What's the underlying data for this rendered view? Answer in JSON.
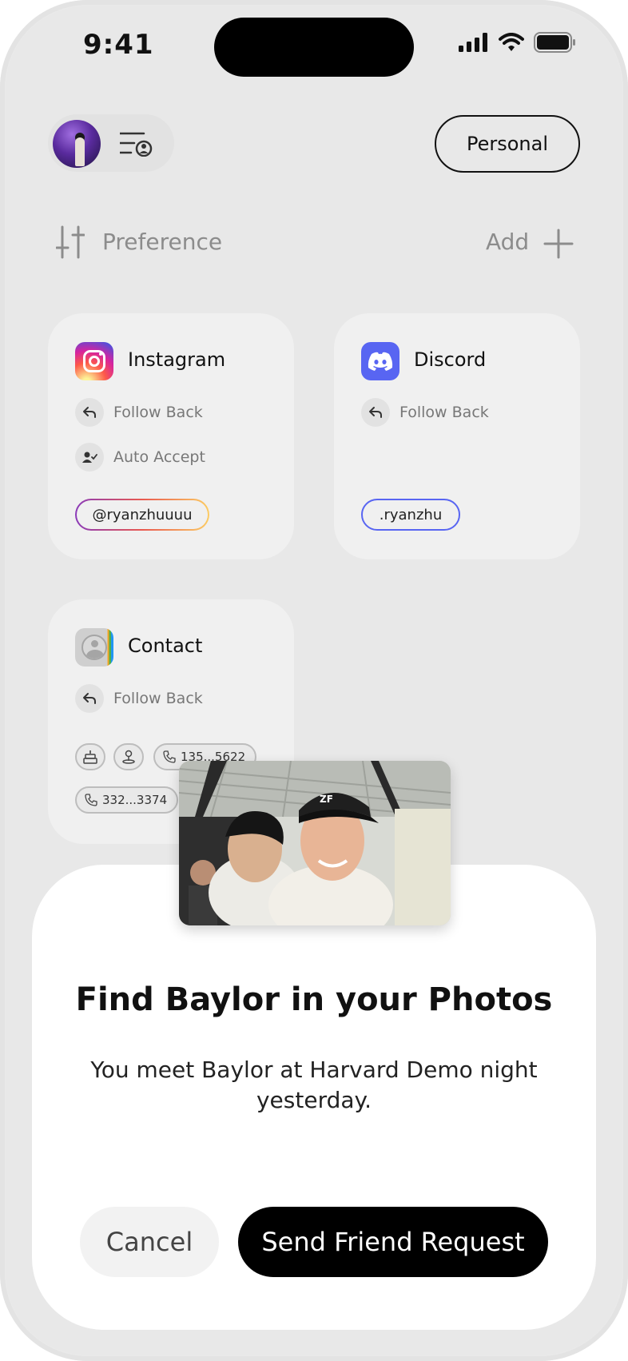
{
  "status_bar": {
    "time": "9:41",
    "icons": [
      "signal-icon",
      "wifi-icon",
      "battery-icon"
    ]
  },
  "header": {
    "avatar_icon": "avatar",
    "menu_icon": "menu-person-icon",
    "mode_button": "Personal"
  },
  "toolbar": {
    "preference_label": "Preference",
    "preference_icon": "sliders-icon",
    "add_label": "Add",
    "add_icon": "plus-icon"
  },
  "cards": {
    "instagram": {
      "name": "Instagram",
      "icon": "instagram-icon",
      "options": [
        {
          "label": "Follow Back",
          "icon": "reply-arrow-icon"
        },
        {
          "label": "Auto Accept",
          "icon": "person-check-icon"
        }
      ],
      "handle": "@ryanzhuuuu"
    },
    "discord": {
      "name": "Discord",
      "icon": "discord-icon",
      "options": [
        {
          "label": "Follow Back",
          "icon": "reply-arrow-icon"
        }
      ],
      "handle": ".ryanzhu",
      "accent": "#5865f2"
    },
    "contact": {
      "name": "Contact",
      "icon": "contacts-icon",
      "options": [
        {
          "label": "Follow Back",
          "icon": "reply-arrow-icon"
        }
      ],
      "chips": [
        {
          "icon": "cake-icon"
        },
        {
          "icon": "pin-icon"
        },
        {
          "icon": "phone-icon",
          "text": "135...5622"
        },
        {
          "icon": "phone-icon",
          "text": "332...3374"
        }
      ]
    }
  },
  "sheet": {
    "photo_icon": "selfie-photo",
    "title": "Find Baylor in your Photos",
    "subtitle": "You meet Baylor at Harvard Demo night yesterday.",
    "cancel_label": "Cancel",
    "send_label": "Send Friend Request"
  }
}
